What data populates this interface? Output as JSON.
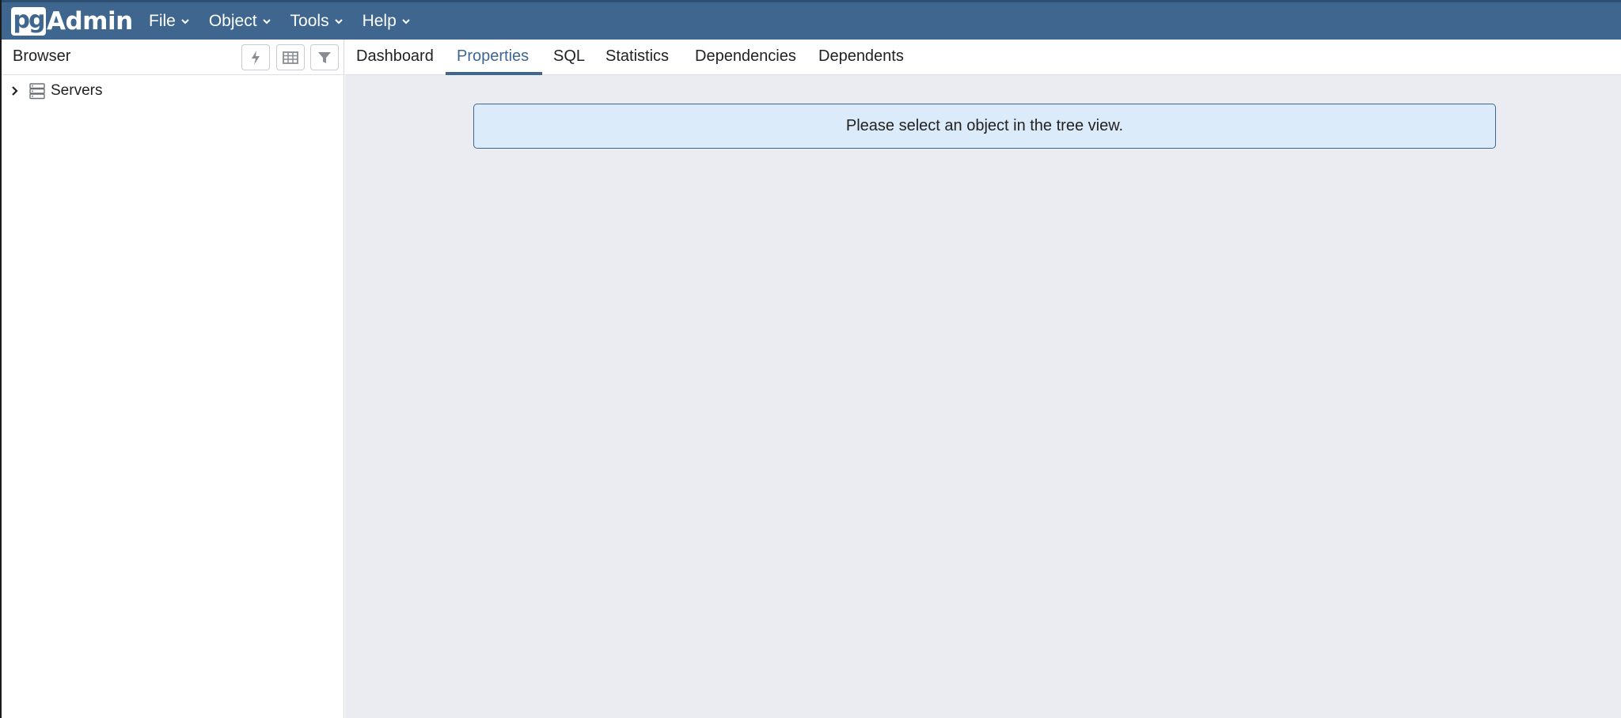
{
  "navbar": {
    "brand_pg": "pg",
    "brand_admin": "Admin",
    "menus": [
      {
        "label": "File"
      },
      {
        "label": "Object"
      },
      {
        "label": "Tools"
      },
      {
        "label": "Help"
      }
    ]
  },
  "browser": {
    "title": "Browser",
    "toolbar": [
      "query-tool-icon",
      "view-data-icon",
      "filter-icon"
    ],
    "tree": [
      {
        "label": "Servers",
        "icon": "server-group-icon",
        "expanded": false
      }
    ]
  },
  "main": {
    "tabs": [
      {
        "label": "Dashboard"
      },
      {
        "label": "Properties"
      },
      {
        "label": "SQL"
      },
      {
        "label": "Statistics"
      },
      {
        "label": "Dependencies"
      },
      {
        "label": "Dependents"
      }
    ],
    "active_tab": "Properties",
    "message": "Please select an object in the tree view."
  },
  "colors": {
    "navbar": "#3e668f",
    "accent": "#3e668f",
    "alert_bg": "#dbebf9",
    "main_bg": "#ebecf1"
  }
}
